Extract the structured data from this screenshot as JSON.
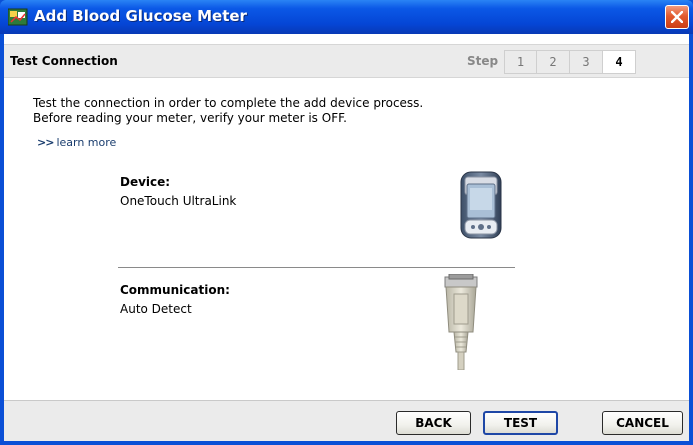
{
  "window": {
    "title": "Add Blood Glucose Meter"
  },
  "header": {
    "title": "Test Connection",
    "step_label": "Step",
    "steps": [
      "1",
      "2",
      "3",
      "4"
    ],
    "active_step": "4"
  },
  "intro": {
    "line1": "Test the connection in order to complete the add device process.",
    "line2": "Before reading your meter, verify your meter is OFF.",
    "learn_more": "learn more",
    "learn_more_arrows": ">>"
  },
  "device": {
    "label": "Device:",
    "value": "OneTouch UltraLink",
    "icon": "glucose-meter-image"
  },
  "communication": {
    "label": "Communication:",
    "value": "Auto Detect",
    "icon": "serial-cable-image"
  },
  "footer": {
    "back_label": "BACK",
    "test_label": "TEST",
    "cancel_label": "CANCEL"
  },
  "colors": {
    "titlebar": "#0546d6",
    "close": "#e35a2e",
    "header_bg": "#ebebeb",
    "link": "#1a3d6e",
    "test_border": "#1e47a6"
  }
}
